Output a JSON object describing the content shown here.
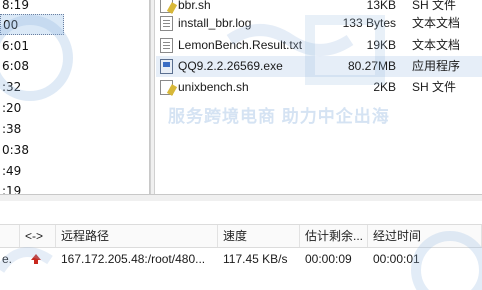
{
  "left_pane": {
    "times": [
      "8:19",
      "00",
      "6:01",
      "6:08",
      ":32",
      ":20",
      ":38",
      "0:38",
      ":49",
      ":19"
    ]
  },
  "files": [
    {
      "name": "bbr.sh",
      "size": "13KB",
      "type": "SH 文件",
      "icon": "shell-script-icon"
    },
    {
      "name": "install_bbr.log",
      "size": "133 Bytes",
      "type": "文本文档",
      "icon": "text-file-icon"
    },
    {
      "name": "LemonBench.Result.txt",
      "size": "19KB",
      "type": "文本文档",
      "icon": "text-file-icon"
    },
    {
      "name": "QQ9.2.2.26569.exe",
      "size": "80.27MB",
      "type": "应用程序",
      "icon": "exe-file-icon"
    },
    {
      "name": "unixbench.sh",
      "size": "2KB",
      "type": "SH 文件",
      "icon": "shell-script-icon"
    }
  ],
  "watermark": {
    "text": "服务跨境电商 助力中企出海"
  },
  "queue": {
    "headers": {
      "direction": "<->",
      "remote_path": "远程路径",
      "speed": "速度",
      "remaining": "估计剩余...",
      "elapsed": "经过时间"
    },
    "row": {
      "local_fragment": "e.",
      "remote_path": "167.172.205.48:/root/480...",
      "speed": "117.45 KB/s",
      "remaining": "00:00:09",
      "elapsed": "00:00:01",
      "direction_icon": "upload-arrow-icon",
      "direction_color": "#c8281e"
    }
  },
  "colors": {
    "selection": "#dbe9f7",
    "watermark": "#96b9e1",
    "upload_arrow": "#c8281e"
  }
}
